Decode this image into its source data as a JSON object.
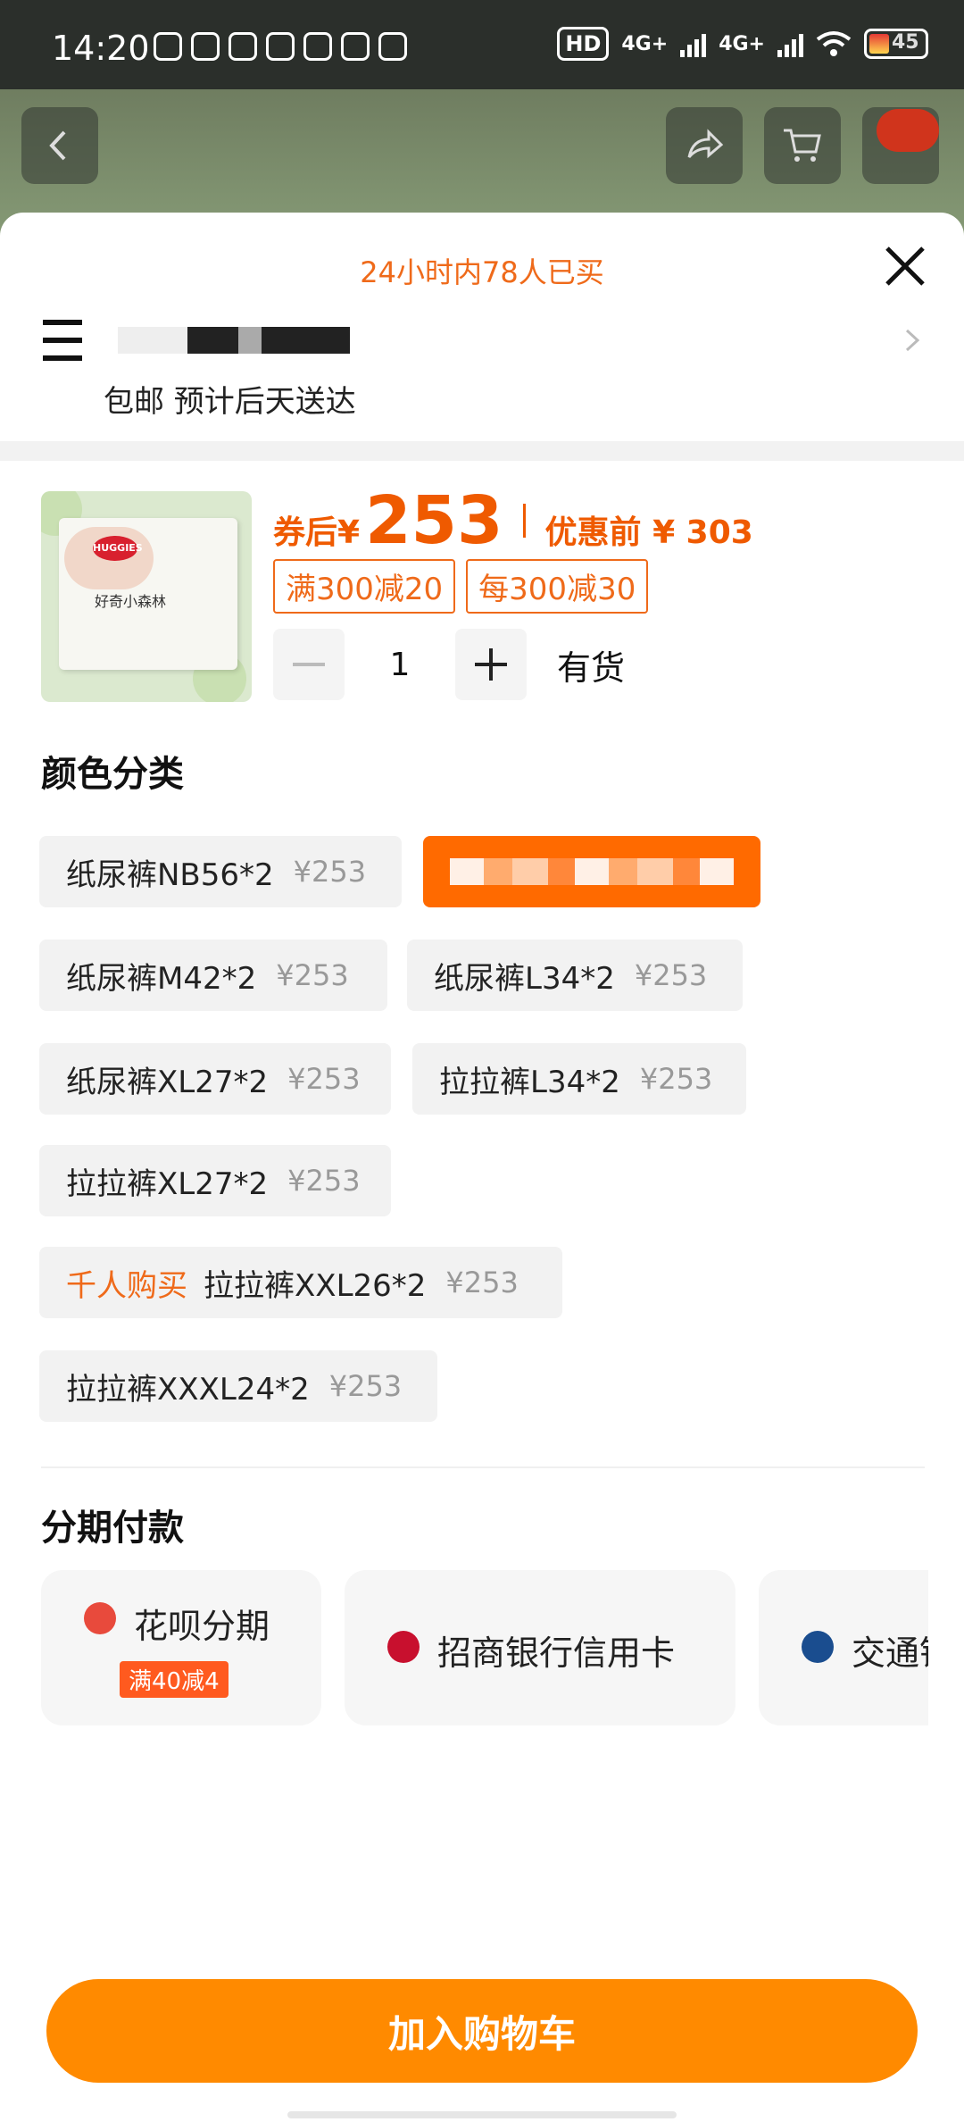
{
  "status_bar": {
    "time": "14:20",
    "hd": "HD",
    "net1": "4G+",
    "net2": "4G+",
    "battery": "45"
  },
  "header": {
    "bought_notice": "24小时内78人已买",
    "shipping": "包邮 预计后天送达"
  },
  "product": {
    "price_label": "券后¥",
    "price": "253",
    "orig_label": "优惠前 ¥ 303",
    "tags": [
      "满300减20",
      "每300减30"
    ],
    "quantity": "1",
    "stock": "有货",
    "thumb_brand": "HUGGIES",
    "thumb_name": "好奇小森林"
  },
  "color_section": {
    "title": "颜色分类",
    "options": [
      {
        "name": "纸尿裤NB56*2",
        "price": "¥253"
      },
      {
        "name": "",
        "price": ""
      },
      {
        "name": "纸尿裤M42*2",
        "price": "¥253"
      },
      {
        "name": "纸尿裤L34*2",
        "price": "¥253"
      },
      {
        "name": "纸尿裤XL27*2",
        "price": "¥253"
      },
      {
        "name": "拉拉裤L34*2",
        "price": "¥253"
      },
      {
        "name": "拉拉裤XL27*2",
        "price": "¥253"
      },
      {
        "name": "拉拉裤XXL26*2",
        "price": "¥253",
        "hot": "千人购买"
      },
      {
        "name": "拉拉裤XXXL24*2",
        "price": "¥253"
      }
    ]
  },
  "installment": {
    "title": "分期付款",
    "options": [
      {
        "name": "花呗分期",
        "badge": "满40减4",
        "icon_text": "分期"
      },
      {
        "name": "招商银行信用卡"
      },
      {
        "name": "交通银行"
      }
    ]
  },
  "cart_button": "加入购物车",
  "colors": {
    "accent": "#ff6a00",
    "button": "#ff8a00",
    "price": "#ef5a00"
  }
}
